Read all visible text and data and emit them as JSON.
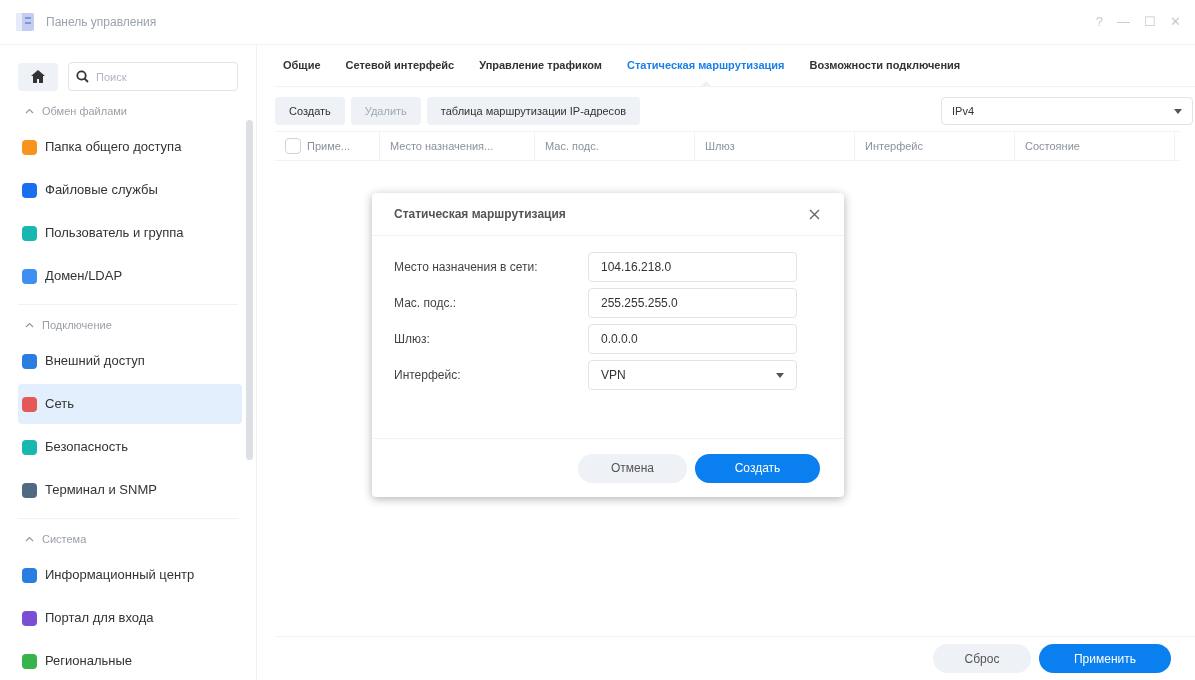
{
  "window": {
    "title": "Панель управления",
    "controls": [
      "?",
      "—",
      "☐",
      "✕"
    ]
  },
  "sidebar": {
    "search_placeholder": "Поиск",
    "sections": [
      {
        "title": "Обмен файлами",
        "expanded": true,
        "items": [
          {
            "label": "Папка общего доступа",
            "selected": false
          },
          {
            "label": "Файловые службы",
            "selected": false
          },
          {
            "label": "Пользователь и группа",
            "selected": false
          },
          {
            "label": "Домен/LDAP",
            "selected": false
          }
        ]
      },
      {
        "title": "Подключение",
        "expanded": true,
        "items": [
          {
            "label": "Внешний доступ",
            "selected": false
          },
          {
            "label": "Сеть",
            "selected": true
          },
          {
            "label": "Безопасность",
            "selected": false
          },
          {
            "label": "Терминал и SNMP",
            "selected": false
          }
        ]
      },
      {
        "title": "Система",
        "expanded": true,
        "items": [
          {
            "label": "Информационный центр",
            "selected": false
          },
          {
            "label": "Портал для входа",
            "selected": false
          },
          {
            "label": "Региональные",
            "selected": false
          }
        ]
      }
    ]
  },
  "tabs": [
    {
      "label": "Общие",
      "selected": false
    },
    {
      "label": "Сетевой интерфейс",
      "selected": false
    },
    {
      "label": "Управление трафиком",
      "selected": false
    },
    {
      "label": "Статическая маршрутизация",
      "selected": true
    },
    {
      "label": "Возможности подключения",
      "selected": false
    }
  ],
  "toolbar": {
    "buttons": [
      {
        "label": "Создать",
        "disabled": false
      },
      {
        "label": "Удалить",
        "disabled": true
      },
      {
        "label": "таблица маршрутизации IP-адресов",
        "disabled": false
      }
    ],
    "ip_version": "IPv4"
  },
  "table": {
    "select_all_checked": false,
    "columns": [
      "Приме...",
      "Место назначения...",
      "Мас. подс.",
      "Шлюз",
      "Интерфейс",
      "Состояние"
    ]
  },
  "dialog": {
    "title": "Статическая маршрутизация",
    "fields": [
      {
        "label": "Место назначения в сети:",
        "value": "104.16.218.0",
        "kind": "text"
      },
      {
        "label": "Мас. подс.:",
        "value": "255.255.255.0",
        "kind": "text"
      },
      {
        "label": "Шлюз:",
        "value": "0.0.0.0",
        "kind": "text"
      },
      {
        "label": "Интерфейс:",
        "value": "VPN",
        "kind": "select"
      }
    ],
    "buttons": [
      {
        "label": "Отмена",
        "primary": false
      },
      {
        "label": "Создать",
        "primary": true
      }
    ]
  },
  "footer": {
    "buttons": [
      {
        "label": "Сброс",
        "primary": false
      },
      {
        "label": "Применить",
        "primary": true
      }
    ]
  }
}
